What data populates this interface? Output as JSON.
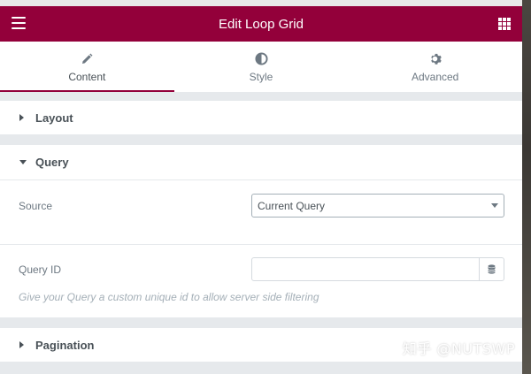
{
  "header": {
    "title": "Edit Loop Grid",
    "menu_icon": "hamburger-icon",
    "apps_icon": "grid-icon",
    "bg_color": "#93003a"
  },
  "tabs": [
    {
      "label": "Content",
      "icon": "pencil-icon",
      "active": true
    },
    {
      "label": "Style",
      "icon": "half-circle-icon",
      "active": false
    },
    {
      "label": "Advanced",
      "icon": "gear-icon",
      "active": false
    }
  ],
  "sections": {
    "layout": {
      "label": "Layout",
      "expanded": false
    },
    "query": {
      "label": "Query",
      "expanded": true,
      "source": {
        "label": "Source",
        "value": "Current Query"
      },
      "query_id": {
        "label": "Query ID",
        "value": "",
        "placeholder": "",
        "help": "Give your Query a custom unique id to allow server side filtering"
      }
    },
    "pagination": {
      "label": "Pagination",
      "expanded": false
    }
  },
  "watermark": "知乎 @NUTSWP"
}
